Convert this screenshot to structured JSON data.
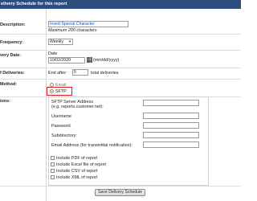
{
  "header": {
    "title": "elivery Schedule for this report"
  },
  "labels": {
    "description": "Description:",
    "frequency": "Frequency:",
    "delivery_date": "very Date:",
    "end_of_deliveries": "f Deliveries:",
    "method": "Method:",
    "options": "ions:"
  },
  "description": {
    "value": "Insert Special Character",
    "hint": "Maximum 200 characters"
  },
  "frequency": {
    "selected": "Weekly"
  },
  "date": {
    "caption": "Date",
    "value": "10/02/2020",
    "format": "(mm/dd/yyyy)"
  },
  "end_of_deliveries": {
    "prefix": "End after:",
    "count": "5",
    "suffix": "total deliveries"
  },
  "method": {
    "options": [
      {
        "label": "Email",
        "checked": false
      },
      {
        "label": "SFTP",
        "checked": true
      }
    ]
  },
  "sftp": {
    "server_label_1": "SFTP Server Address",
    "server_label_2": "(e.g. reports.customer.net):",
    "username_label": "Username",
    "password_label": "Password",
    "subdirectory_label": "Subdirectory:",
    "email_label": "Email Address (for transmittal notification):",
    "checkboxes": [
      "Include PDF of report",
      "Include Excel file of report",
      "Include CSV of report",
      "Include XML of report"
    ]
  },
  "save_button": "Save Delivery Schedule",
  "colors": {
    "header_bg": "#2c4d7d",
    "highlight": "#e01a1a",
    "link": "#1a4fb5"
  }
}
